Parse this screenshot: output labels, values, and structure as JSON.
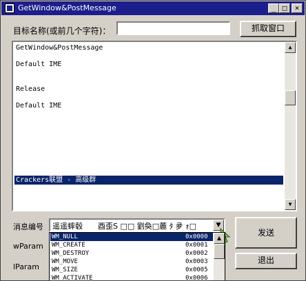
{
  "window": {
    "title": "GetWindow&PostMessage"
  },
  "target": {
    "label": "目标名称(或前几个字符)：",
    "value": "",
    "grab_button": "抓取窗口"
  },
  "output": {
    "lines": [
      "GetWindow&PostMessage",
      "Default IME",
      "Release",
      "Default IME"
    ],
    "selected_line": "Crackers联盟 - 高级群"
  },
  "message": {
    "label": "消息编号",
    "combo_value": "遥遥蟀毂　　酉歪S □□ 劉奐□蔍 ﾀ 夛 ｫ□",
    "options": [
      {
        "name": "WM_NULL",
        "value": "0x0000"
      },
      {
        "name": "WM_CREATE",
        "value": "0x0001"
      },
      {
        "name": "WM_DESTROY",
        "value": "0x0002"
      },
      {
        "name": "WM_MOVE",
        "value": "0x0003"
      },
      {
        "name": "WM_SIZE",
        "value": "0x0005"
      },
      {
        "name": "WM_ACTIVATE",
        "value": "0x0006"
      }
    ]
  },
  "wparam": {
    "label": "wParam"
  },
  "lparam": {
    "label": "lParam"
  },
  "buttons": {
    "send": "发送",
    "exit": "退出"
  }
}
